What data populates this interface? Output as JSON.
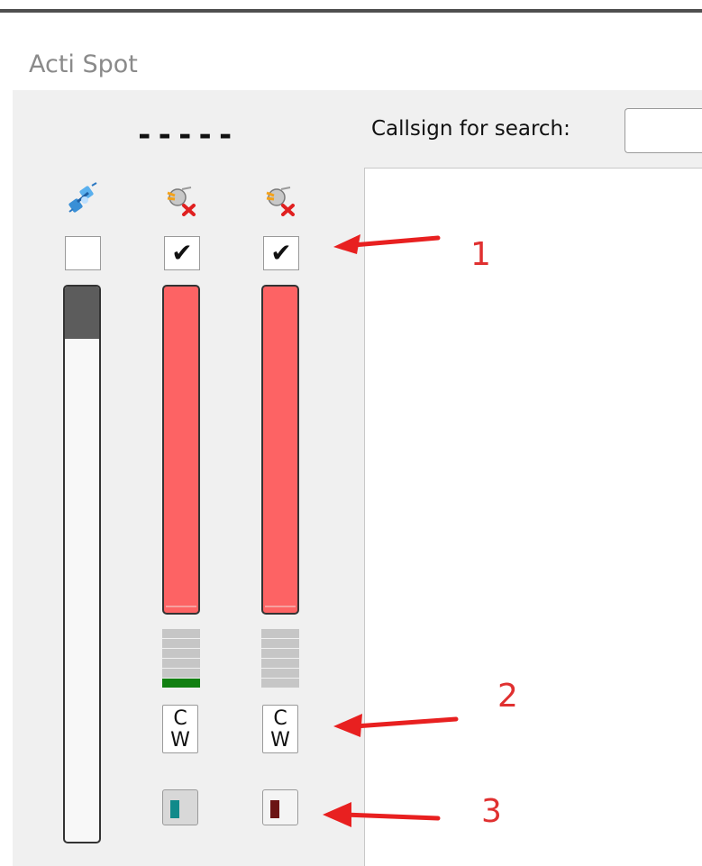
{
  "window": {
    "title": "Acti Spot"
  },
  "frequency_display": "-----",
  "search": {
    "label": "Callsign for search:",
    "value": ""
  },
  "columns": [
    {
      "id": "connection",
      "icon": "network-connection-icon",
      "checked": false,
      "check_glyph": "",
      "meter_type": "scrollbar"
    },
    {
      "id": "radio-1",
      "icon": "disconnected-satellite-icon",
      "checked": true,
      "check_glyph": "✔",
      "meter_type": "bar",
      "mode_top": "C",
      "mode_bottom": "W",
      "indicator_color": "#118a8a",
      "signal_lit": 1
    },
    {
      "id": "radio-2",
      "icon": "disconnected-satellite-icon",
      "checked": true,
      "check_glyph": "✔",
      "meter_type": "bar",
      "mode_top": "C",
      "mode_bottom": "W",
      "indicator_color": "#6b1414",
      "signal_lit": 0
    }
  ],
  "annotations": [
    {
      "label": "1"
    },
    {
      "label": "2"
    },
    {
      "label": "3"
    }
  ],
  "colors": {
    "level_bar": "#fd6364",
    "signal_on": "#128012",
    "signal_off": "#c6c6c6",
    "annotation": "#e03030"
  }
}
